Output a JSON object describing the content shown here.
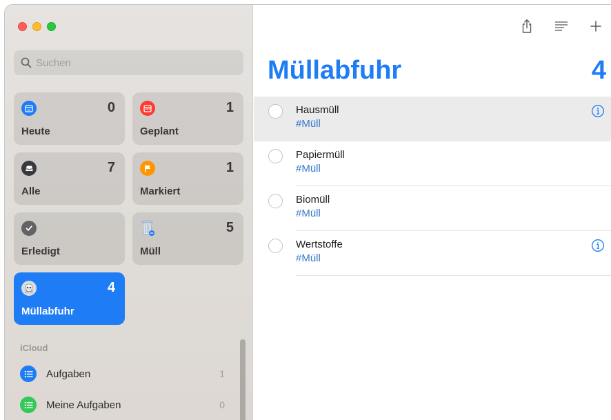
{
  "sidebar": {
    "search": {
      "placeholder": "Suchen",
      "value": ""
    },
    "smart_lists": [
      {
        "label": "Heute",
        "count": "0",
        "icon": "calendar-today-icon",
        "color": "#1e7cf5"
      },
      {
        "label": "Geplant",
        "count": "1",
        "icon": "calendar-icon",
        "color": "#ff3b30"
      },
      {
        "label": "Alle",
        "count": "7",
        "icon": "tray-icon",
        "color": "#3a3a3c"
      },
      {
        "label": "Markiert",
        "count": "1",
        "icon": "flag-icon",
        "color": "#ff9500"
      },
      {
        "label": "Erledigt",
        "count": "",
        "icon": "checkmark-icon",
        "color": "#636366"
      },
      {
        "label": "Müll",
        "count": "5",
        "icon": "trash-icon",
        "color": "#8e8e93"
      },
      {
        "label": "Müllabfuhr",
        "count": "4",
        "icon": "skull-icon",
        "color": "#1e7cf5",
        "selected": true
      }
    ],
    "section_title": "iCloud",
    "lists": [
      {
        "name": "Aufgaben",
        "count": "1",
        "icon": "list-bullet-icon",
        "color": "#1e7cf5"
      },
      {
        "name": "Meine Aufgaben",
        "count": "0",
        "icon": "list-bullet-icon",
        "color": "#34c759"
      }
    ]
  },
  "main": {
    "title": "Müllabfuhr",
    "count": "4",
    "toolbar": [
      "share-icon",
      "sort-lines-icon",
      "plus-icon"
    ],
    "tasks": [
      {
        "name": "Hausmüll",
        "tag": "#Müll",
        "selected": true,
        "info": true
      },
      {
        "name": "Papiermüll",
        "tag": "#Müll",
        "selected": false,
        "info": false
      },
      {
        "name": "Biomüll",
        "tag": "#Müll",
        "selected": false,
        "info": false
      },
      {
        "name": "Wertstoffe",
        "tag": "#Müll",
        "selected": false,
        "info": true
      }
    ]
  },
  "colors": {
    "accent": "#1e7cf5",
    "tag": "#3a78c8"
  }
}
